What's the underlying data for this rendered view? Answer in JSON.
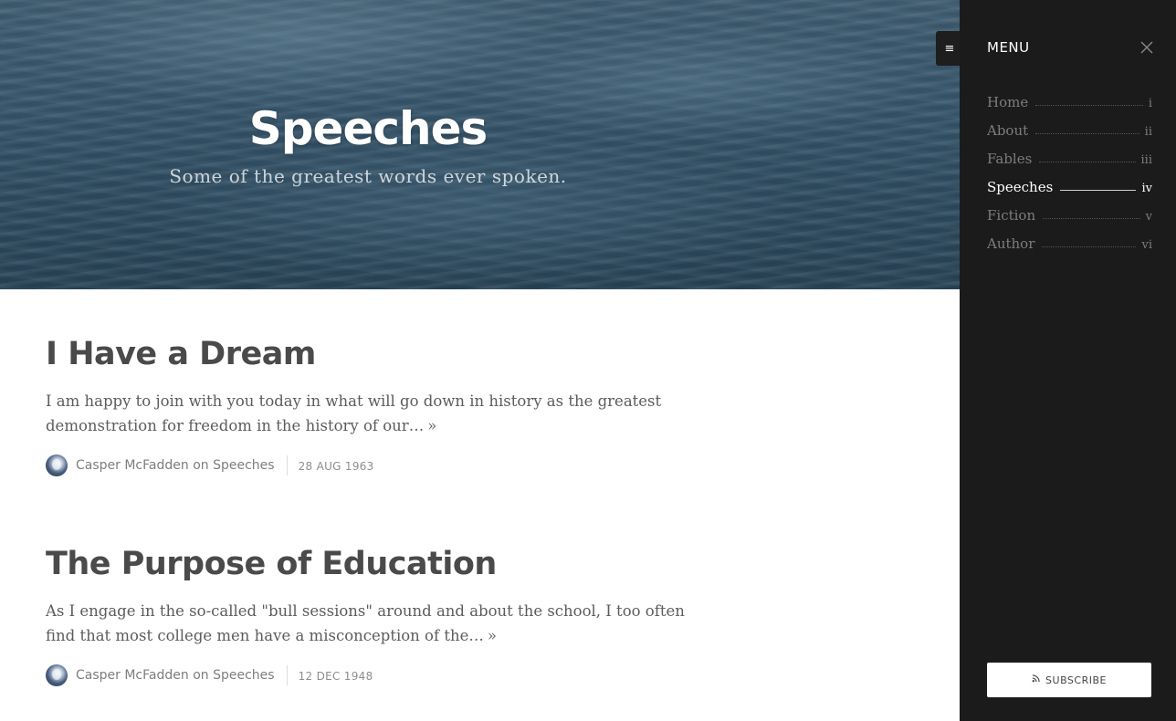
{
  "hero": {
    "title": "Speeches",
    "subtitle": "Some of the greatest words ever spoken."
  },
  "menu_toggle": {
    "icon": "hamburger-icon",
    "glyph": "≡"
  },
  "posts": [
    {
      "title": "I Have a Dream",
      "excerpt": "I am happy to join with you today in what will go down in history as the greatest demonstration for freedom in the history of our…",
      "more": "»",
      "author": "Casper McFadden",
      "on": "on",
      "tag": "Speeches",
      "date": "28 AUG 1963"
    },
    {
      "title": "The Purpose of Education",
      "excerpt": "As I engage in the so-called \"bull sessions\" around and about the school, I too often find that most college men have a misconception of the…",
      "more": "»",
      "author": "Casper McFadden",
      "on": "on",
      "tag": "Speeches",
      "date": "12 DEC 1948"
    }
  ],
  "sidebar": {
    "heading": "MENU",
    "close_icon": "close-icon",
    "items": [
      {
        "label": "Home",
        "num": "i",
        "active": false
      },
      {
        "label": "About",
        "num": "ii",
        "active": false
      },
      {
        "label": "Fables",
        "num": "iii",
        "active": false
      },
      {
        "label": "Speeches",
        "num": "iv",
        "active": true
      },
      {
        "label": "Fiction",
        "num": "v",
        "active": false
      },
      {
        "label": "Author",
        "num": "vi",
        "active": false
      }
    ],
    "subscribe": {
      "label": "SUBSCRIBE",
      "icon": "rss-icon",
      "glyph": "◔"
    }
  },
  "colors": {
    "sidebar_bg": "#1b1b1b",
    "title_text": "#4a4a4a",
    "body_text": "#5c5c5c",
    "active_nav": "#ffffff"
  }
}
